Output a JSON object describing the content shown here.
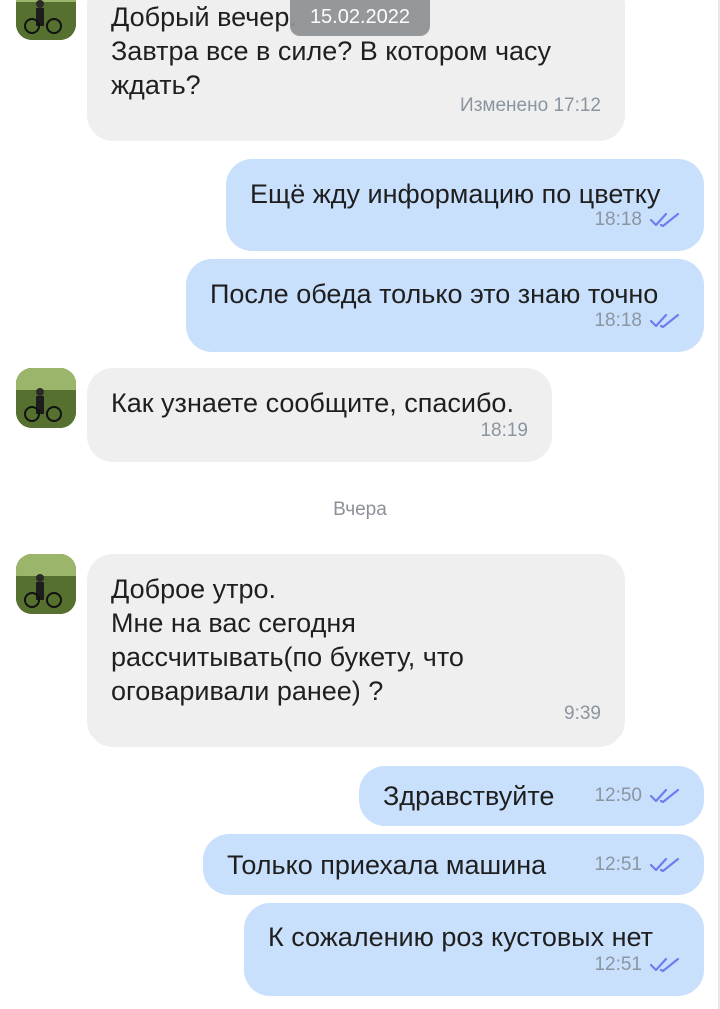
{
  "date_pill": "15.02.2022",
  "separator": "Вчера",
  "messages": [
    {
      "text": "Добрый вечер.\nЗавтра все в силе? В котором часу\nждать?",
      "time": "Изменено  17:12"
    },
    {
      "text": "Ещё жду информацию по цветку",
      "time": "18:18"
    },
    {
      "text": "После обеда только это знаю точно",
      "time": "18:18"
    },
    {
      "text": "Как узнаете сообщите, спасибо.",
      "time": "18:19"
    },
    {
      "text": "Доброе утро.\nМне на вас сегодня\nрассчитывать(по букету, что\nоговаривали ранее) ?",
      "time": "9:39"
    },
    {
      "text": "Здравствуйте",
      "time": "12:50"
    },
    {
      "text": "Только приехала машина",
      "time": "12:51"
    },
    {
      "text": "К сожалению роз кустовых нет",
      "time": "12:51"
    }
  ],
  "icons": {
    "read": "double-check-icon",
    "avatar": "contact-photo"
  },
  "colors": {
    "incoming_bubble": "#efefef",
    "outgoing_bubble": "#c9e0fd",
    "check": "#6c7df0",
    "time": "#8a95a0"
  }
}
